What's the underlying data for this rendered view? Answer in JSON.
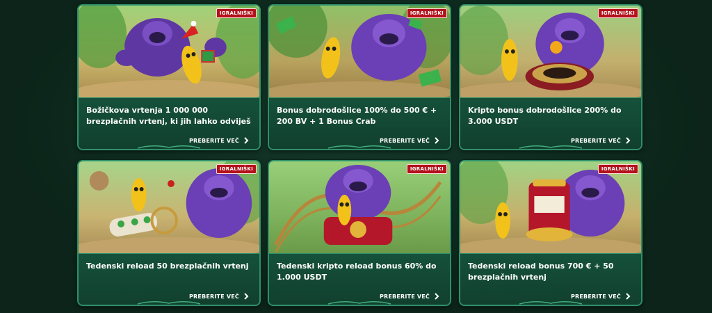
{
  "cards": [
    {
      "badge": "IGRALNIŠKI",
      "title": "Božičkova vrtenja 1 000 000 brezplačnih vrtenj, ki jih lahko odviješ",
      "cta": "PREBERITE VEČ",
      "art": "christmas-gorilla-banana"
    },
    {
      "badge": "IGRALNIŠKI",
      "title": "Bonus dobrodošlice 100% do 500 € + 200 BV + 1 Bonus Crab",
      "cta": "PREBERITE VEČ",
      "art": "money-gorilla-banana"
    },
    {
      "badge": "IGRALNIŠKI",
      "title": "Kripto bonus dobrodošlice 200% do 3.000 USDT",
      "cta": "PREBERITE VEČ",
      "art": "roulette-gorilla-banana"
    },
    {
      "badge": "IGRALNIŠKI",
      "title": "Tedenski reload 50 brezplačnih vrtenj",
      "cta": "PREBERITE VEČ",
      "art": "reel-gorilla-banana"
    },
    {
      "badge": "IGRALNIŠKI",
      "title": "Tedenski kripto reload bonus 60% do 1.000 USDT",
      "cta": "PREBERITE VEČ",
      "art": "rollercoaster-gorilla-banana"
    },
    {
      "badge": "IGRALNIŠKI",
      "title": "Tedenski reload bonus 700 € + 50 brezplačnih vrtenj",
      "cta": "PREBERITE VEČ",
      "art": "slot-machine-gorilla-banana"
    }
  ],
  "colors": {
    "background": "#0e2a1f",
    "card_border": "#2f8f6a",
    "card_text_bg": "#15513b",
    "badge": "#b3121c",
    "gorilla": "#6b3fb5",
    "banana": "#f2c21b"
  }
}
